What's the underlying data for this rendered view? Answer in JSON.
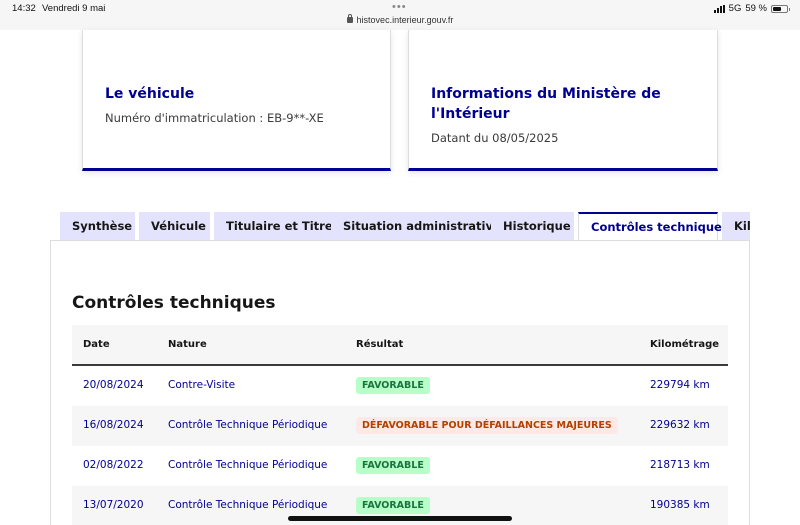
{
  "status_bar": {
    "time": "14:32",
    "date": "Vendredi 9 mai",
    "url": "histovec.interieur.gouv.fr",
    "network": "5G",
    "battery": "59 %",
    "battery_level": 0.59
  },
  "cards": {
    "vehicle": {
      "title": "Le véhicule",
      "plate_text": "Numéro d'immatriculation : EB-9**-XE"
    },
    "ministry": {
      "title": "Informations du Ministère de l'Intérieur",
      "date_text": "Datant du 08/05/2025"
    }
  },
  "tabs": [
    {
      "label": "Synthèse",
      "active": false
    },
    {
      "label": "Véhicule",
      "active": false
    },
    {
      "label": "Titulaire et Titre",
      "active": false
    },
    {
      "label": "Situation administrative",
      "active": false
    },
    {
      "label": "Historique",
      "active": false
    },
    {
      "label": "Contrôles techniques",
      "active": true
    },
    {
      "label": "Kilométrage",
      "active": false
    }
  ],
  "section": {
    "title": "Contrôles techniques"
  },
  "table": {
    "headers": {
      "date": "Date",
      "nature": "Nature",
      "result": "Résultat",
      "km": "Kilométrage"
    },
    "rows": [
      {
        "date": "20/08/2024",
        "nature": "Contre-Visite",
        "result": "FAVORABLE",
        "status": "ok",
        "km": "229794 km"
      },
      {
        "date": "16/08/2024",
        "nature": "Contrôle Technique Périodique",
        "result": "DÉFAVORABLE POUR DÉFAILLANCES MAJEURES",
        "status": "ko",
        "km": "229632 km"
      },
      {
        "date": "02/08/2022",
        "nature": "Contrôle Technique Périodique",
        "result": "FAVORABLE",
        "status": "ok",
        "km": "218713 km"
      },
      {
        "date": "13/07/2020",
        "nature": "Contrôle Technique Périodique",
        "result": "FAVORABLE",
        "status": "ok",
        "km": "190385 km"
      }
    ]
  },
  "colors": {
    "primary": "#000091",
    "tab_bg": "#e3e3fd",
    "success_bg": "#b8fec9",
    "success_text": "#18753c",
    "error_bg": "#ffe9e6",
    "error_text": "#b34000"
  }
}
